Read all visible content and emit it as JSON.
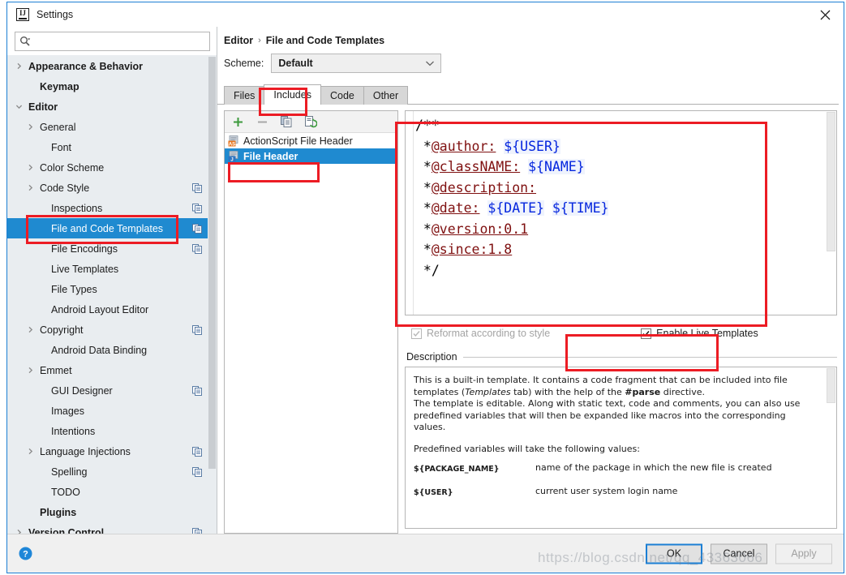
{
  "window": {
    "title": "Settings",
    "app_icon": "intellij-idea-icon",
    "close_icon": "close-icon"
  },
  "search": {
    "placeholder": "",
    "value": "",
    "icon": "search-icon"
  },
  "sidebar": {
    "items": [
      {
        "label": "Appearance & Behavior",
        "indent": 0,
        "arrow": "chevron-right",
        "bold": true,
        "copy": false,
        "selected": false
      },
      {
        "label": "Keymap",
        "indent": 1,
        "arrow": "none",
        "bold": true,
        "copy": false,
        "selected": false
      },
      {
        "label": "Editor",
        "indent": 0,
        "arrow": "chevron-down",
        "bold": true,
        "copy": false,
        "selected": false
      },
      {
        "label": "General",
        "indent": 1,
        "arrow": "chevron-right",
        "bold": false,
        "copy": false,
        "selected": false
      },
      {
        "label": "Font",
        "indent": 2,
        "arrow": "none",
        "bold": false,
        "copy": false,
        "selected": false
      },
      {
        "label": "Color Scheme",
        "indent": 1,
        "arrow": "chevron-right",
        "bold": false,
        "copy": false,
        "selected": false
      },
      {
        "label": "Code Style",
        "indent": 1,
        "arrow": "chevron-right",
        "bold": false,
        "copy": true,
        "selected": false
      },
      {
        "label": "Inspections",
        "indent": 2,
        "arrow": "none",
        "bold": false,
        "copy": true,
        "selected": false
      },
      {
        "label": "File and Code Templates",
        "indent": 2,
        "arrow": "none",
        "bold": false,
        "copy": true,
        "selected": true
      },
      {
        "label": "File Encodings",
        "indent": 2,
        "arrow": "none",
        "bold": false,
        "copy": true,
        "selected": false
      },
      {
        "label": "Live Templates",
        "indent": 2,
        "arrow": "none",
        "bold": false,
        "copy": false,
        "selected": false
      },
      {
        "label": "File Types",
        "indent": 2,
        "arrow": "none",
        "bold": false,
        "copy": false,
        "selected": false
      },
      {
        "label": "Android Layout Editor",
        "indent": 2,
        "arrow": "none",
        "bold": false,
        "copy": false,
        "selected": false
      },
      {
        "label": "Copyright",
        "indent": 1,
        "arrow": "chevron-right",
        "bold": false,
        "copy": true,
        "selected": false
      },
      {
        "label": "Android Data Binding",
        "indent": 2,
        "arrow": "none",
        "bold": false,
        "copy": false,
        "selected": false
      },
      {
        "label": "Emmet",
        "indent": 1,
        "arrow": "chevron-right",
        "bold": false,
        "copy": false,
        "selected": false
      },
      {
        "label": "GUI Designer",
        "indent": 2,
        "arrow": "none",
        "bold": false,
        "copy": true,
        "selected": false
      },
      {
        "label": "Images",
        "indent": 2,
        "arrow": "none",
        "bold": false,
        "copy": false,
        "selected": false
      },
      {
        "label": "Intentions",
        "indent": 2,
        "arrow": "none",
        "bold": false,
        "copy": false,
        "selected": false
      },
      {
        "label": "Language Injections",
        "indent": 1,
        "arrow": "chevron-right",
        "bold": false,
        "copy": true,
        "selected": false
      },
      {
        "label": "Spelling",
        "indent": 2,
        "arrow": "none",
        "bold": false,
        "copy": true,
        "selected": false
      },
      {
        "label": "TODO",
        "indent": 2,
        "arrow": "none",
        "bold": false,
        "copy": false,
        "selected": false
      },
      {
        "label": "Plugins",
        "indent": 1,
        "arrow": "none",
        "bold": true,
        "copy": false,
        "selected": false
      },
      {
        "label": "Version Control",
        "indent": 0,
        "arrow": "chevron-right",
        "bold": true,
        "copy": true,
        "selected": false
      }
    ]
  },
  "breadcrumb": {
    "parent": "Editor",
    "separator": "›",
    "current": "File and Code Templates"
  },
  "scheme": {
    "label": "Scheme:",
    "value": "Default",
    "caret_icon": "chevron-down-icon"
  },
  "tabs": [
    {
      "label": "Files",
      "active": false
    },
    {
      "label": "Includes",
      "active": true
    },
    {
      "label": "Code",
      "active": false
    },
    {
      "label": "Other",
      "active": false
    }
  ],
  "list_toolbar": [
    {
      "name": "add-button",
      "icon": "plus-icon"
    },
    {
      "name": "remove-button",
      "icon": "minus-icon"
    },
    {
      "name": "copy-button",
      "icon": "copy-icon"
    },
    {
      "name": "reset-button",
      "icon": "reset-icon"
    }
  ],
  "template_list": [
    {
      "label": "ActionScript File Header",
      "badge": "AS",
      "badge_color": "#e8761e",
      "selected": false
    },
    {
      "label": "File Header",
      "badge": "J",
      "badge_color": "#2f74c0",
      "selected": true
    }
  ],
  "editor": {
    "lines": [
      [
        {
          "t": "/**",
          "k": "plain"
        }
      ],
      [
        {
          "t": " *",
          "k": "plain"
        },
        {
          "t": "@author:",
          "k": "tag"
        },
        {
          "t": " ",
          "k": "plain"
        },
        {
          "t": "${USER}",
          "k": "var"
        }
      ],
      [
        {
          "t": " *",
          "k": "plain"
        },
        {
          "t": "@classNAME:",
          "k": "tag"
        },
        {
          "t": " ",
          "k": "plain"
        },
        {
          "t": "${NAME}",
          "k": "var"
        }
      ],
      [
        {
          "t": " *",
          "k": "plain"
        },
        {
          "t": "@description:",
          "k": "tag"
        }
      ],
      [
        {
          "t": " *",
          "k": "plain"
        },
        {
          "t": "@date:",
          "k": "tag"
        },
        {
          "t": " ",
          "k": "plain"
        },
        {
          "t": "${DATE}",
          "k": "var"
        },
        {
          "t": " ",
          "k": "plain"
        },
        {
          "t": "${TIME}",
          "k": "var"
        }
      ],
      [
        {
          "t": " *",
          "k": "plain"
        },
        {
          "t": "@version:0.1",
          "k": "tag"
        }
      ],
      [
        {
          "t": " *",
          "k": "plain"
        },
        {
          "t": "@since:1.8",
          "k": "tag"
        }
      ],
      [
        {
          "t": " */",
          "k": "plain"
        }
      ]
    ]
  },
  "checkboxes": {
    "reformat": {
      "label_pre": "R",
      "label_mnemonic": "",
      "label": "Reformat according to style",
      "checked": true,
      "disabled": true
    },
    "enable_live": {
      "label": "Enable Live Templates",
      "mnemonic": "L",
      "checked": true,
      "disabled": false
    }
  },
  "description": {
    "header": "Description",
    "paragraph1_a": "This is a built-in template. It contains a code fragment that can be included into file templates (",
    "paragraph1_italic": "Templates",
    "paragraph1_b": " tab) with the help of the ",
    "paragraph1_bold": "#parse",
    "paragraph1_c": " directive.",
    "paragraph2": "The template is editable. Along with static text, code and comments, you can also use predefined variables that will then be expanded like macros into the corresponding values.",
    "paragraph3": "Predefined variables will take the following values:",
    "variables": [
      {
        "name": "${PACKAGE_NAME}",
        "desc": "name of the package in which the new file is created"
      },
      {
        "name": "${USER}",
        "desc": "current user system login name"
      }
    ]
  },
  "bottom": {
    "help_icon": "help-icon",
    "buttons": [
      {
        "label": "OK",
        "style": "primary",
        "disabled": false
      },
      {
        "label": "Cancel",
        "style": "normal",
        "disabled": false
      },
      {
        "label": "Apply",
        "style": "normal",
        "disabled": true
      }
    ]
  },
  "watermark": "https://blog.csdn.net/qq_43363066",
  "colors": {
    "selection_blue": "#1f8ad0",
    "annotation_red": "#ec1c24",
    "code_tag": "#7f1010",
    "code_var": "#0526de",
    "window_border": "#1c7fd4",
    "sidebar_bg": "#e9edf0"
  }
}
